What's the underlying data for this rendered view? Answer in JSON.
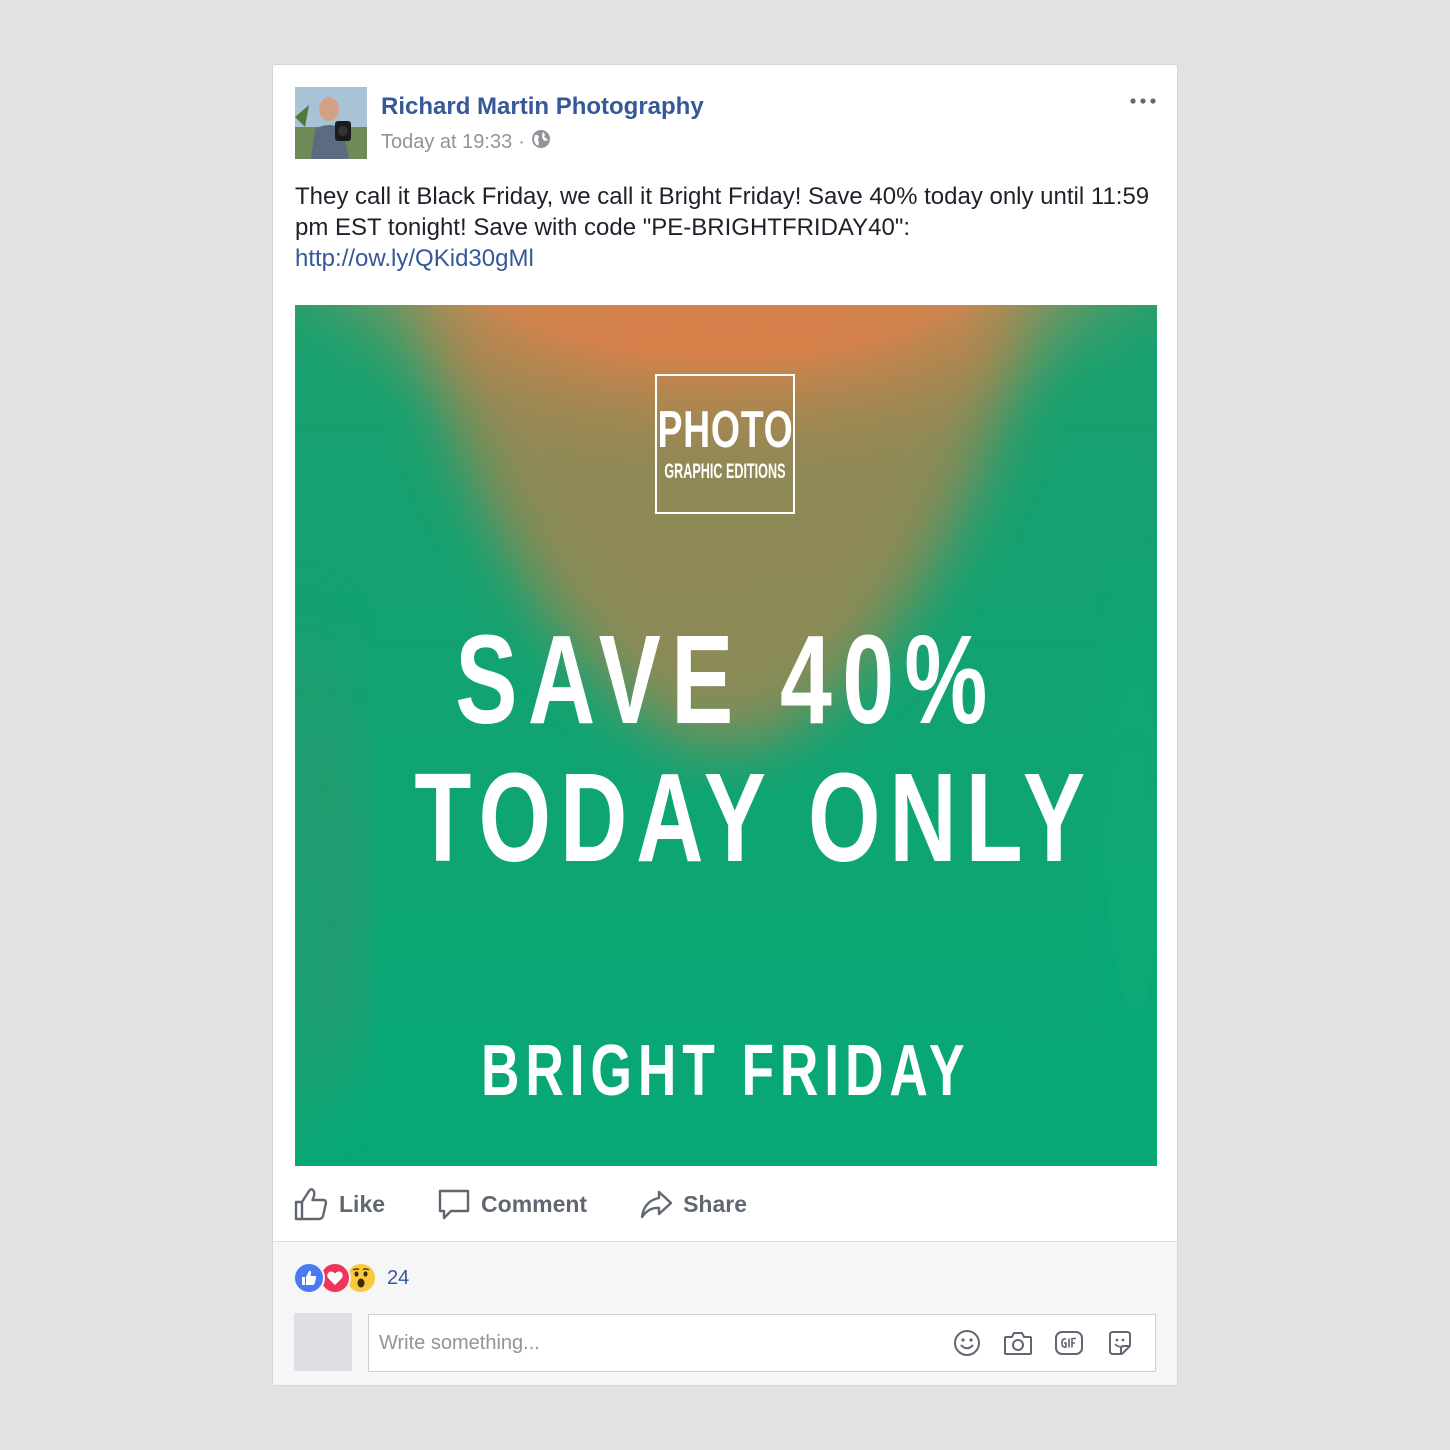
{
  "post": {
    "page_name": "Richard Martin Photography",
    "timestamp": "Today at 19:33",
    "separator": "·",
    "audience_icon": "globe-icon",
    "text_main": "They call it Black Friday, we call it Bright Friday! Save 40% today only until 11:59 pm EST tonight! Save with code \"PE-BRIGHTFRIDAY40\": ",
    "link_text": "http://ow.ly/QKid30gMl"
  },
  "image": {
    "logo_line1": "PHOTO",
    "logo_line2": "GRAPHIC EDITIONS",
    "headline_line1": "SAVE 40%",
    "headline_line2": "TODAY ONLY",
    "tagline": "BRIGHT FRIDAY",
    "colors": {
      "top": "#ff3b2f",
      "middle": "#f07a45",
      "bottom": "#0aa874"
    }
  },
  "actions": {
    "like": "Like",
    "comment": "Comment",
    "share": "Share"
  },
  "reactions": {
    "icons": [
      "like-reaction-icon",
      "love-reaction-icon",
      "wow-reaction-icon"
    ],
    "count": "24"
  },
  "comment_box": {
    "placeholder": "Write something...",
    "icons": [
      "emoji-icon",
      "camera-icon",
      "gif-icon",
      "sticker-icon"
    ]
  },
  "colors": {
    "link": "#365899",
    "action_text": "#616770",
    "like_blue": "#4a79f2",
    "love_red": "#f0355a",
    "wow_yellow": "#f9c93c"
  }
}
